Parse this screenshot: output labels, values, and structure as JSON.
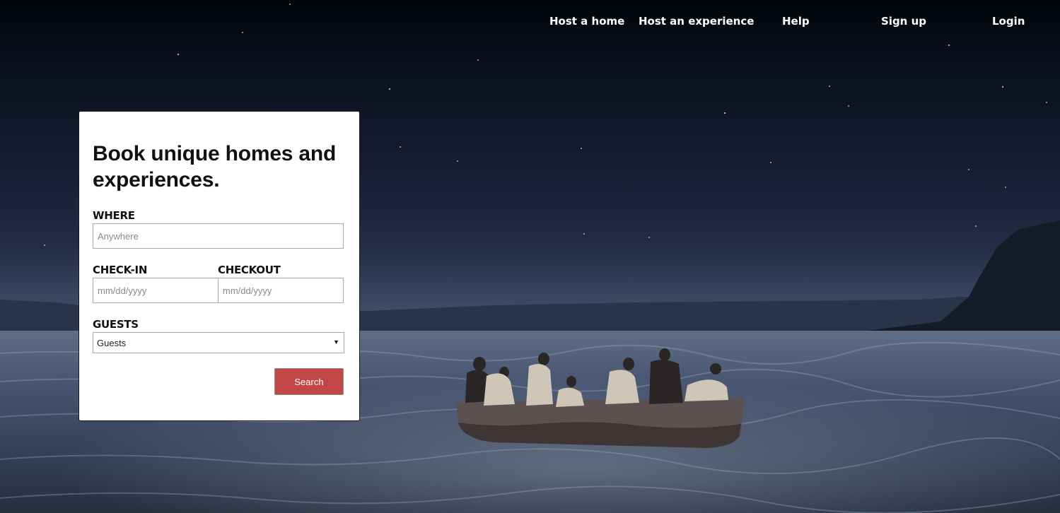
{
  "nav": {
    "host_home": "Host a home",
    "host_experience": "Host an experience",
    "help": "Help",
    "sign_up": "Sign up",
    "login": "Login"
  },
  "booking": {
    "title": "Book unique homes and experiences.",
    "where_label": "WHERE",
    "where_placeholder": "Anywhere",
    "checkin_label": "CHECK-IN",
    "checkin_placeholder": "mm/dd/yyyy",
    "checkout_label": "CHECKOUT",
    "checkout_placeholder": "mm/dd/yyyy",
    "guests_label": "GUESTS",
    "guests_value": "Guests",
    "search_label": "Search"
  },
  "colors": {
    "accent": "#c44747",
    "nav_text": "#ffffff"
  },
  "background": {
    "icon": "hero-photo-boat-at-night"
  }
}
